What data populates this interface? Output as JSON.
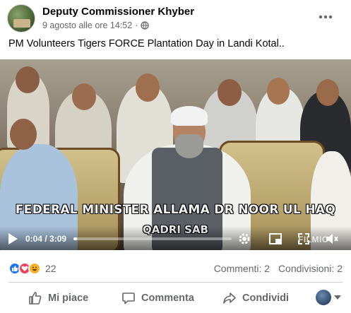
{
  "post": {
    "page_name": "Deputy Commissioner Khyber",
    "timestamp": "9 agosto alle ore 14:52",
    "privacy_icon": "globe-icon",
    "more_icon": "more-horizontal-icon",
    "caption": "PM Volunteers Tigers FORCE Plantation Day in Landi Kotal.."
  },
  "video": {
    "overlay_title": "FEDERAL MINISTER ALLAMA DR NOOR UL HAQ",
    "overlay_subtitle": "QADRI SAB",
    "current_time": "0:04",
    "duration": "3:09",
    "time_label": "0:04 / 3:09",
    "progress": 0.021,
    "watermark": "FILMIC",
    "controls": [
      "play-icon",
      "settings-icon",
      "pip-icon",
      "fullscreen-icon",
      "volume-icon"
    ]
  },
  "engagement": {
    "reactions": [
      "like",
      "love",
      "haha"
    ],
    "reaction_count": "22",
    "comments": "Commenti: 2",
    "shares": "Condivisioni: 2"
  },
  "actions": {
    "like": "Mi piace",
    "comment": "Commenta",
    "share": "Condividi"
  },
  "colors": {
    "meta_text": "#65676b",
    "like_blue": "#1877f2",
    "love_red": "#f33e58",
    "haha_yellow": "#f7b125",
    "divider": "#ced0d4"
  }
}
